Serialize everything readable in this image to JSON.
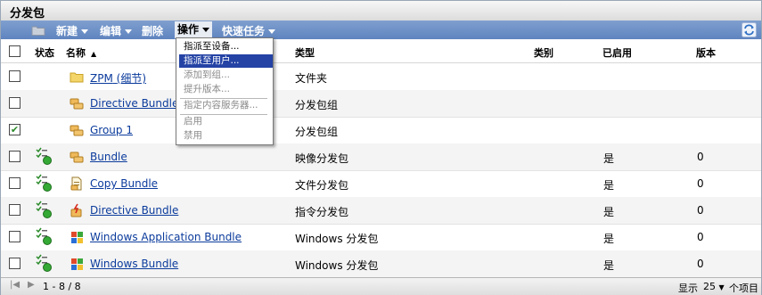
{
  "panel": {
    "title": "分发包"
  },
  "toolbar": {
    "new": "新建",
    "edit": "编辑",
    "delete": "删除",
    "actions": "操作",
    "quick_tasks": "快速任务"
  },
  "columns": {
    "status": "状态",
    "name": "名称",
    "type": "类型",
    "category": "类别",
    "enabled": "已启用",
    "version": "版本"
  },
  "menu": {
    "items": [
      {
        "label": "指派至设备...",
        "enabled": true
      },
      {
        "label": "指派至用户...",
        "enabled": true,
        "highlighted": true
      },
      {
        "label": "添加到组...",
        "enabled": false
      },
      {
        "label": "提升版本...",
        "enabled": false
      },
      {
        "label": "指定内容服务器...",
        "enabled": false
      },
      {
        "label": "启用",
        "enabled": false
      },
      {
        "label": "禁用",
        "enabled": false
      }
    ]
  },
  "rows": [
    {
      "name": "ZPM",
      "name_suffix": "(细节)",
      "icon": "folder-icon",
      "type": "文件夹",
      "enabled": "",
      "version": "",
      "checked": false
    },
    {
      "name": "Directive Bundle",
      "icon": "bundle-group-icon",
      "type": "分发包组",
      "enabled": "",
      "version": "",
      "checked": false
    },
    {
      "name": "Group 1",
      "icon": "bundle-group-icon",
      "type": "分发包组",
      "enabled": "",
      "version": "",
      "checked": true
    },
    {
      "name": "Bundle",
      "icon": "image-bundle-icon",
      "type": "映像分发包",
      "enabled": "是",
      "version": "0",
      "checked": false
    },
    {
      "name": "Copy Bundle",
      "icon": "file-bundle-icon",
      "type": "文件分发包",
      "enabled": "是",
      "version": "0",
      "checked": false
    },
    {
      "name": "Directive Bundle",
      "icon": "directive-bundle-icon",
      "type": "指令分发包",
      "enabled": "是",
      "version": "0",
      "checked": false
    },
    {
      "name": "Windows Application Bundle",
      "icon": "windows-bundle-icon",
      "type": "Windows 分发包",
      "enabled": "是",
      "version": "0",
      "checked": false
    },
    {
      "name": "Windows Bundle",
      "icon": "windows-bundle-icon",
      "type": "Windows 分发包",
      "enabled": "是",
      "version": "0",
      "checked": false
    }
  ],
  "footer": {
    "range": "1 - 8 / 8",
    "show_label": "显示",
    "page_size": "25",
    "per_page_label": "个项目"
  },
  "colors": {
    "toolbar": "#6a8cc6",
    "link": "#0b3b9c",
    "menu_highlight": "#2443a5"
  }
}
